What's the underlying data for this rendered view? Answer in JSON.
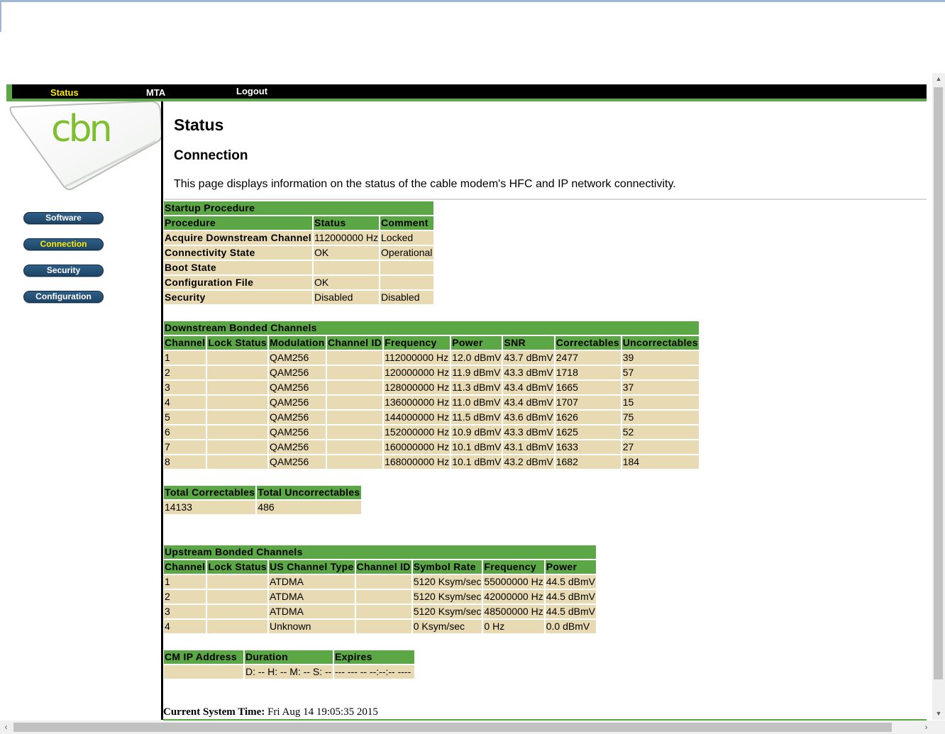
{
  "nav": {
    "status": "Status",
    "mta": "MTA",
    "logout": "Logout"
  },
  "logo": {
    "text": "cbn",
    "color": "#7dbf2d"
  },
  "sidebar": {
    "software": "Software",
    "connection": "Connection",
    "security": "Security",
    "configuration": "Configuration"
  },
  "page": {
    "title": "Status",
    "section": "Connection",
    "description": "This page displays information on the status of the cable modem's HFC and IP network connectivity."
  },
  "startup": {
    "title": "Startup Procedure",
    "headers": [
      "Procedure",
      "Status",
      "Comment"
    ],
    "rows": [
      [
        "Acquire Downstream Channel",
        "112000000 Hz",
        "Locked"
      ],
      [
        "Connectivity State",
        "OK",
        "Operational"
      ],
      [
        "Boot State",
        "",
        ""
      ],
      [
        "Configuration File",
        "OK",
        ""
      ],
      [
        "Security",
        "Disabled",
        "Disabled"
      ]
    ]
  },
  "downstream": {
    "title": "Downstream Bonded Channels",
    "headers": [
      "Channel",
      "Lock Status",
      "Modulation",
      "Channel ID",
      "Frequency",
      "Power",
      "SNR",
      "Correctables",
      "Uncorrectables"
    ],
    "rows": [
      [
        "1",
        "",
        "QAM256",
        "",
        "112000000 Hz",
        "12.0 dBmV",
        "43.7 dBmV",
        "2477",
        "39"
      ],
      [
        "2",
        "",
        "QAM256",
        "",
        "120000000 Hz",
        "11.9 dBmV",
        "43.3 dBmV",
        "1718",
        "57"
      ],
      [
        "3",
        "",
        "QAM256",
        "",
        "128000000 Hz",
        "11.3 dBmV",
        "43.4 dBmV",
        "1665",
        "37"
      ],
      [
        "4",
        "",
        "QAM256",
        "",
        "136000000 Hz",
        "11.0 dBmV",
        "43.4 dBmV",
        "1707",
        "15"
      ],
      [
        "5",
        "",
        "QAM256",
        "",
        "144000000 Hz",
        "11.5 dBmV",
        "43.6 dBmV",
        "1626",
        "75"
      ],
      [
        "6",
        "",
        "QAM256",
        "",
        "152000000 Hz",
        "10.9 dBmV",
        "43.3 dBmV",
        "1625",
        "52"
      ],
      [
        "7",
        "",
        "QAM256",
        "",
        "160000000 Hz",
        "10.1 dBmV",
        "43.1 dBmV",
        "1633",
        "27"
      ],
      [
        "8",
        "",
        "QAM256",
        "",
        "168000000 Hz",
        "10.1 dBmV",
        "43.2 dBmV",
        "1682",
        "184"
      ]
    ]
  },
  "totals": {
    "headers": [
      "Total Correctables",
      "Total Uncorrectables"
    ],
    "values": [
      "14133",
      "486"
    ]
  },
  "upstream": {
    "title": "Upstream Bonded Channels",
    "headers": [
      "Channel",
      "Lock Status",
      "US Channel Type",
      "Channel ID",
      "Symbol Rate",
      "Frequency",
      "Power"
    ],
    "rows": [
      [
        "1",
        "",
        "ATDMA",
        "",
        "5120 Ksym/sec",
        "55000000 Hz",
        "44.5 dBmV"
      ],
      [
        "2",
        "",
        "ATDMA",
        "",
        "5120 Ksym/sec",
        "42000000 Hz",
        "44.5 dBmV"
      ],
      [
        "3",
        "",
        "ATDMA",
        "",
        "5120 Ksym/sec",
        "48500000 Hz",
        "44.5 dBmV"
      ],
      [
        "4",
        "",
        "Unknown",
        "",
        "0 Ksym/sec",
        "0 Hz",
        "0.0 dBmV"
      ]
    ]
  },
  "ip": {
    "headers": [
      "CM IP Address",
      "Duration",
      "Expires"
    ],
    "values": [
      "",
      "D: -- H: -- M: -- S: --",
      "--- --- -- --:--:-- ----"
    ]
  },
  "system_time": {
    "label": "Current System Time:",
    "value": "Fri Aug 14 19:05:35 2015"
  },
  "colors": {
    "header_green": "#5ca745",
    "cell_tan": "#e8dbb4",
    "nav_black": "#000000",
    "active_yellow": "#ffeb00",
    "button_blue": "#2e5e86"
  }
}
